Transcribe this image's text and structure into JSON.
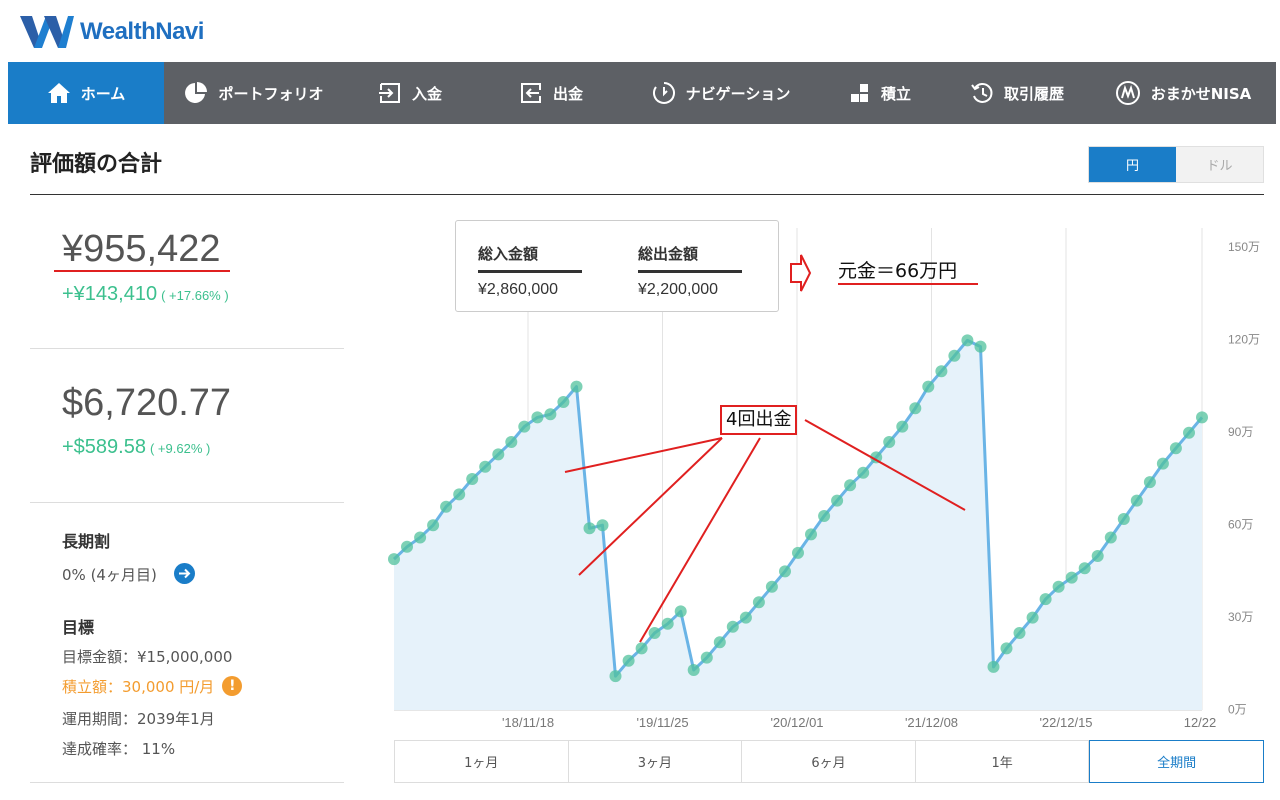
{
  "brand": {
    "name": "WealthNavi"
  },
  "nav": [
    {
      "label": "ホーム",
      "icon": "home-icon",
      "active": true
    },
    {
      "label": "ポートフォリオ",
      "icon": "pie-chart-icon"
    },
    {
      "label": "入金",
      "icon": "deposit-icon"
    },
    {
      "label": "出金",
      "icon": "withdraw-icon"
    },
    {
      "label": "ナビゲーション",
      "icon": "navigation-icon"
    },
    {
      "label": "積立",
      "icon": "blocks-icon"
    },
    {
      "label": "取引履歴",
      "icon": "history-icon"
    },
    {
      "label": "おまかせNISA",
      "icon": "nisa-icon"
    }
  ],
  "page": {
    "title": "評価額の合計"
  },
  "currency_toggle": {
    "jpy": "円",
    "usd": "ドル",
    "selected": "円"
  },
  "summary": {
    "jpy_total": "¥955,422",
    "jpy_gain": "+¥143,410",
    "jpy_gain_pct": "( +17.66% )",
    "usd_total": "$6,720.77",
    "usd_gain": "+$589.58",
    "usd_gain_pct": "( +9.62% )"
  },
  "long_term": {
    "label": "長期割",
    "value": "0% (4ヶ月目)"
  },
  "goal": {
    "label": "目標",
    "amount": "目標金額：¥15,000,000",
    "contribution": "積立額：30,000 円/月",
    "period": "運用期間：2039年1月",
    "probability": "達成確率： 11%"
  },
  "tooltip": {
    "deposit_label": "総入金額",
    "deposit_value": "¥2,860,000",
    "withdraw_label": "総出金額",
    "withdraw_value": "¥2,200,000"
  },
  "annotations": {
    "principal": "元金＝66万円",
    "withdrawals": "4回出金"
  },
  "chart_data": {
    "type": "line",
    "x_ticks": [
      "'18/11/18",
      "'19/11/25",
      "'20/12/01",
      "'21/12/08",
      "'22/12/15",
      "12/22"
    ],
    "y_ticks": [
      "150万",
      "120万",
      "90万",
      "60万",
      "30万",
      "0万"
    ],
    "ylim": [
      0,
      1500000
    ],
    "series": [
      {
        "values": [
          490000,
          530000,
          560000,
          600000,
          660000,
          700000,
          750000,
          790000,
          830000,
          870000,
          920000,
          950000,
          960000,
          1000000,
          1050000,
          590000,
          600000,
          110000,
          160000,
          200000,
          250000,
          280000,
          320000,
          130000,
          170000,
          220000,
          270000,
          300000,
          350000,
          400000,
          450000,
          510000,
          570000,
          630000,
          680000,
          730000,
          770000,
          820000,
          870000,
          920000,
          980000,
          1050000,
          1100000,
          1150000,
          1200000,
          1180000,
          140000,
          200000,
          250000,
          300000,
          360000,
          400000,
          430000,
          460000,
          500000,
          560000,
          620000,
          680000,
          740000,
          800000,
          850000,
          900000,
          950000
        ]
      }
    ]
  },
  "periods": [
    {
      "label": "1ヶ月"
    },
    {
      "label": "3ヶ月"
    },
    {
      "label": "6ヶ月"
    },
    {
      "label": "1年"
    },
    {
      "label": "全期間",
      "selected": true
    }
  ]
}
